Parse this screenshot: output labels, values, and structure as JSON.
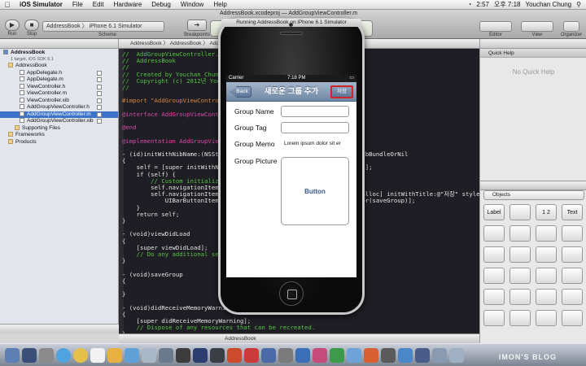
{
  "menubar": {
    "apple": "",
    "app": "iOS Simulator",
    "menus": [
      "File",
      "Edit",
      "Hardware",
      "Debug",
      "Window",
      "Help"
    ],
    "time": "오후 7:18",
    "user": "Youchan Chung",
    "battery": "2:57"
  },
  "toolbar": {
    "run": "Run",
    "stop": "Stop",
    "scheme": "Scheme",
    "breakpoints": "Breakpoints",
    "scheme_value": "AddressBook  〉  iPhone 6.1 Simulator",
    "editor": "Editor",
    "view": "View",
    "organizer": "Organizer",
    "window_title": "AddressBook.xcodeproj  —  AddGroupViewController.m"
  },
  "navigator": {
    "items": [
      {
        "label": "AddressBook",
        "sub": "1 target, iOS SDK 6.1",
        "type": "project"
      },
      {
        "label": "AddressBook",
        "type": "folder"
      },
      {
        "label": "AppDelegate.h",
        "type": "file"
      },
      {
        "label": "AppDelegate.m",
        "type": "file"
      },
      {
        "label": "ViewController.h",
        "type": "file"
      },
      {
        "label": "ViewController.m",
        "type": "file"
      },
      {
        "label": "ViewController.xib",
        "type": "file"
      },
      {
        "label": "AddGroupViewController.h",
        "type": "file"
      },
      {
        "label": "AddGroupViewController.m",
        "type": "file",
        "selected": true
      },
      {
        "label": "AddGroupViewController.xib",
        "type": "file"
      },
      {
        "label": "Supporting Files",
        "type": "folder"
      },
      {
        "label": "Frameworks",
        "type": "folder"
      },
      {
        "label": "Products",
        "type": "folder"
      }
    ]
  },
  "jumpbar": "AddressBook  〉  AddressBook  〉  AddGroupViewController.m  〉  -initWithNibName:bundle:",
  "code": {
    "lines": [
      {
        "cls": "cm",
        "t": "//  AddGroupViewController.m"
      },
      {
        "cls": "cm",
        "t": "//  AddressBook"
      },
      {
        "cls": "cm",
        "t": "//"
      },
      {
        "cls": "cm",
        "t": "//  Created by Youchan Chung on 13. 4. 2."
      },
      {
        "cls": "cm",
        "t": "//  Copyright (c) 2012년 Youchan Chung. All rights reserved."
      },
      {
        "cls": "cm",
        "t": "//"
      },
      {
        "cls": "",
        "t": ""
      },
      {
        "cls": "pp",
        "t": "#import \"AddGroupViewController.h\""
      },
      {
        "cls": "",
        "t": ""
      },
      {
        "cls": "kw",
        "t": "@interface AddGroupViewController ()"
      },
      {
        "cls": "",
        "t": ""
      },
      {
        "cls": "kw",
        "t": "@end"
      },
      {
        "cls": "",
        "t": ""
      },
      {
        "cls": "kw",
        "t": "@implementation AddGroupViewController"
      },
      {
        "cls": "",
        "t": ""
      },
      {
        "cls": "",
        "t": "- (id)initWithNibName:(NSString *)nibNameOrNil bundle:(NSBundle *)nibBundleOrNil"
      },
      {
        "cls": "",
        "t": "{"
      },
      {
        "cls": "",
        "t": "    self = [super initWithNibName:nibNameOrNil bundle:nibBundleOrNil];"
      },
      {
        "cls": "",
        "t": "    if (self) {"
      },
      {
        "cls": "cm",
        "t": "        // Custom initialization"
      },
      {
        "cls": "",
        "t": "        self.navigationItem.title = @\"새로운 그룹 추가\";"
      },
      {
        "cls": "",
        "t": "        self.navigationItem.rightBarButtonItem = [[UIBarButtonItem alloc] initWithTitle:@\"저장\" style:"
      },
      {
        "cls": "",
        "t": "            UIBarButtonItemStyleBordered target:self action:@selector(saveGroup)];"
      },
      {
        "cls": "",
        "t": "    }"
      },
      {
        "cls": "",
        "t": "    return self;"
      },
      {
        "cls": "",
        "t": "}"
      },
      {
        "cls": "",
        "t": ""
      },
      {
        "cls": "",
        "t": "- (void)viewDidLoad"
      },
      {
        "cls": "",
        "t": "{"
      },
      {
        "cls": "",
        "t": "    [super viewDidLoad];"
      },
      {
        "cls": "cm",
        "t": "    // Do any additional setup after loading the view from its nib."
      },
      {
        "cls": "",
        "t": "}"
      },
      {
        "cls": "",
        "t": ""
      },
      {
        "cls": "",
        "t": "- (void)saveGroup"
      },
      {
        "cls": "",
        "t": "{"
      },
      {
        "cls": "",
        "t": ""
      },
      {
        "cls": "",
        "t": "}"
      },
      {
        "cls": "",
        "t": ""
      },
      {
        "cls": "",
        "t": "- (void)didReceiveMemoryWarning"
      },
      {
        "cls": "",
        "t": "{"
      },
      {
        "cls": "",
        "t": "    [super didReceiveMemoryWarning];"
      },
      {
        "cls": "cm",
        "t": "    // Dispose of any resources that can be recreated."
      },
      {
        "cls": "",
        "t": "}"
      }
    ]
  },
  "debugbar": "AddressBook",
  "utilities": {
    "quick_help": "Quick Help",
    "no_quick_help": "No Quick Help",
    "objects": "Objects",
    "lib": [
      "Label",
      "",
      "1 2",
      "Text"
    ]
  },
  "simulator": {
    "title": "Running AddressBook on iPhone 6.1 Simulator",
    "carrier": "Carrier",
    "time": "7:18 PM",
    "nav_title": "새로운 그룹 추가",
    "back": "Back",
    "save": "저장",
    "group_name": "Group Name",
    "group_tag": "Group Tag",
    "group_memo": "Group Memo",
    "memo_text": "Lorem ipsum dolor sit er",
    "group_picture": "Group Picture",
    "button": "Button"
  },
  "watermark": "IMON'S BLOG",
  "colors": {
    "selection": "#3b73c8",
    "nav_ios": "#6e86a5",
    "highlight": "#d0262a"
  }
}
